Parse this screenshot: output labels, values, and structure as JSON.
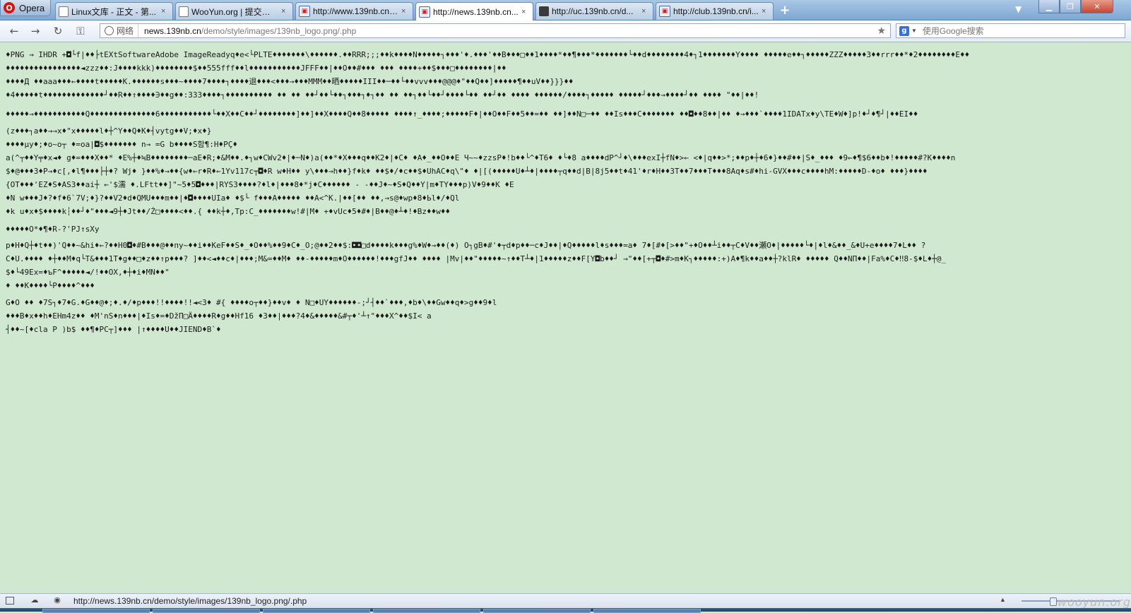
{
  "browser": {
    "menu_label": "Opera",
    "tabs": [
      {
        "label": "Linux文库 - 正文 - 第...",
        "icon": "document-favicon-icon"
      },
      {
        "label": "WooYun.org | 提交漏洞",
        "icon": "document-favicon-icon"
      },
      {
        "label": "http://www.139nb.cn/...",
        "icon": "site-139-favicon-icon"
      },
      {
        "label": "http://news.139nb.cn...",
        "icon": "site-139-favicon-icon",
        "active": true
      },
      {
        "label": "http://uc.139nb.cn/d...",
        "icon": "dark-favicon-icon"
      },
      {
        "label": "http://club.139nb.cn/i...",
        "icon": "site-139-favicon-icon"
      }
    ],
    "tab_close_glyph": "×",
    "add_tab_glyph": "+"
  },
  "address_bar": {
    "site_badge": "网络",
    "url_host": "news.139nb.cn",
    "url_path": "/demo/style/images/139nb_logo.png/.php",
    "search_placeholder": "使用Google搜索"
  },
  "content": {
    "lines": [
      "♦PNG → IHDR +◘└f|♦♦├tEXtSoftwareAdobe ImageReadyq♦e<└PLTE♦♦♦♦♦♦♦\\♦♦♦♦♦♦.♦♦RRR;;;♦♦k♦♦♦♦N♦♦♦♦♦┐♦♦♦'♦.♦♦♦'♦♦B♦♦♦□♦♦1♦♦♦♦*♦♦¶♦♦♦*♦♦♦♦♦♦♦└♦♦d♦♦♦♦♦♦♦♦4♦┐1♦♦♦♦♦♦♦Y♦♦♦♦  ♦♦♦♦♦e♦♦┐♦♦♦♦♦ZZZ♦♦♦♦♦3♦♦rrr♦♦*♦2♦♦♦♦♦♦♦♦E♦♦",
      "♦♦♦♦♦♦♦♦♦♦♦♦♦♦♦♦◄zzz♦♦:J♦♦♦♦kkk)♦♦♦♦♦♦♦♦$♦♦555fff♦♦l♦♦♦♦♦♦♦♦♦♦♦JFFF♦♦|♦♦O♦♦#♦♦♦  ♦♦♦ ♦♦♦♦+♦♦$♦♦♦□♦♦♦♦♦♦♦♦|♦♦",
      "♦♦♦♦Д ♦♦aaa♦♦♦←♦♦♦♦t♦♦♦♦♦K.♦♦♦♦♦♦s♦♦♦~♦♦♦♦7♦♦♦♦┐♦♦♦♦退♦♦♦<♦♦♦→♦♦♦MMM♦♦晒♦♦♦♦♦III♦♦─♦♦└♦♦vvv♦♦♦@@@♦\"♦♦Q♦♦]♦♦♦♦♦¶♦♦uV♦♦}}}♦♦",
      "♦4♦♦♦♦♦t♦♦♦♦♦♦♦♦♦♦♦♦♦┘♦♦R♦♦↑♦♦♦♦∋♦♦g♦♦:333♦♦♦♦┐♦♦♦♦♦♦♦♦♦♦  ♦♦  ♦♦  ♦♦┘♦♦└♦♦┐♦♦♦┐♦┐♦♦  ♦♦  ♦♦┐♦♦└♦♦┘♦♦♦♦└♦♦  ♦♦┘♦♦  ♦♦♦♦  ♦♦♦♦♦♦/♦♦♦♦┐♦♦♦♦♦  ♦♦♦♦♦┘♦♦♦→♦♦♦♦┘♦♦  ♦♦♦♦  \"♦♦|♦♦!",
      "♦♦♦♦♦→♦♦♦♦♦♦♦♦♦♦♦Q♦♦♦♦♦♦♦♦♦♦♦♦♦♦6♦♦♦♦♦♦♦♦♦♦♦└♦♦X♦♦C♦♦┘♦♦♦♦♦♦♦♦]♦♦]♦♦X♦♦♦♦Q♦♦8♦♦♦♦♦ ♦♦♦♦↑_♦♦♦♦;♦♦♦♦♦F♦|♦♦O♦♦F♦♦5♦♦=♦♦  ♦♦]♦♦N□─♦♦  ♦♦Is♦♦♦C♦♦♦♦♦♦♦  ♦♦◘♦♦8♦♦|♦♦ ♦→♦♦♦`♦♦♦♦1IDATx♦y\\TE♦W♦]p!♦┘♦¶┘|♦♦EI♦♦",
      "(z♦♦♦┐a♦♦→→x♦\"x♦♦♦♦♦l♦┼^Y♦♦Q♦K♦┤vytg♦♦V;♦x♦}",
      "♦♦♦♦µy♦;♦o~o┬ ♦=oa|◘$♦♦♦♦♦♦♦ n→ =G b♦♦♦♦S함¶:H♦PÇ♦",
      "a(^┬♦♦Y╤♦x◄♦ g♦=♦♦♦X♦♦* ♦E%┼♦≒B♦♦♦♦♦♦♦♦─aE♦R;♦&M♦♦.♦┐w♦CWv2♦|♦─N♦)a(♦♦*♦X♦♦♦q♦♦K2♦|♦C♦ ♦A♦_♦♦O♦♦E Ч~~♦zzsP♦!b♦♦└^♦T6♦ ♦└♦8 a♦♦♦♦dP^┘♦\\♦♦♦exI┼fN♦>← <♦|q♦♦>*;♦♦p♦┼♦6♦}♦♦#♦♦|S♦_♦♦♦  ♦9←♦¶$6♦♦b♦!♦♦♦♦♦#?K♦♦♦♦n",
      "$♦@♦♦♦3♦P→♦c[,♦l¶♦♦♦├┼♦? Wj♦ }♦♦%♦→♦♦{w♦←r♦R♦←1Yv117c┬◘♦R  w♦H♦♦ y\\♦♦♦→h♦♦}f♦k♦ ♦♦$♦/♦c♦♦$♦UhAC♦q\\\"♦ ♦|[(♦♦♦♦♦U♦┴♦|♦♦♦♦┬q♦♦d|B|8j5♦♦t♦41'♦r♦H♦♦3T♦♦7♦♦♦T♦♦♦8Aq♦s#♦hi-GVX♦♦♦c♦♦♦♦hM:♦♦♦♦♦D-♦o♦ ♦♦♦}♦♦♦♦",
      "{OT♦♦♦'EZ♦S♦AS3♦♦ai┼ ←'$濡 ♦.LFtt♦♦]\"~5♦5◘♦♦♦|RYS3♦♦♦♦?♦l♦|♦♦♦8♦*j♦C♦♦♦♦♦♦ - -♦♦J♦~♦S♦Q♦♦Y|m♦TY♦♦♦p)V♦9♦♦K ♦E",
      "♦N  w♦♦♦J♦?♦f♦6`7V;♦}?♦♦V2♦d♦QMU♦♦♦m♦♦|♦◘♦♦♦♦UIa♦  ♦$└ f♦♦♦A♦♦♦♦♦ ♦♦A<^K.|♦♦[♦♦ ♦♦,→s@♦wp♦8♦Ьl♦/♦Ql",
      "♦k u♦x♦$♦♦♦♦k┆♦♦┘♦\"♦♦♦◄9┼♦Jt♦♦/Ż□♦♦♦♦<♦♦.{ ♦♦k┼♦,Tp:C_♦♦♦♦♦♦♦w!#|M♦  +♦vUc♦5♦#♦|B♦♦@♦┴♦!♦Bz♦♦w♦♦",
      "♦♦♦♦♦O*♦¶♦R-?'PJ↑sXy",
      "p♦H♦Q┼♦t♦♦)'Q♦♦~&hi♦←?♦♦H0◘♦#B♦♦♦@♦♦пy~♦♦i♦♦KeF♦♦S♦_♦O♦♦%♦♦9♦C♦_O;@♦♦2♦♦$:◘◘□d♦♦♦♦k♦♦♦g%♦W♦→♦♦(♦) O┐gB♦#'♦┬d♦p♦♦─c♦J♦♦|♦Q♦♦♦♦♦l♦s♦♦♦=a♦ 7♦[#♦[>♦♦\"+♦O♦♦┴i♦♦┬C♦V♦♦瀬O♦|♦♦♦♦♦└♦|♦l♦&♦♦_&♦U+e♦♦♦♦7♦L♦♦ ?",
      "C♦U.♦♦♦♦ ♦┼♦♦M♦q└T&♦♦♦1T♦g♦♦□♦z♦♦↑p♦♦♦? ]♦♦<◄♦♦c♦|♦♦♦;M&=♦♦M♦ ♦♦-♦♦♦♦♦m♦O♦♦♦♦♦♦!♦♦♦gfJ♦♦ ♦♦♦♦ |Mv|♦♦\"♦♦♦♦♦~↑♦♦T┴♦|1♦♦♦♦♦z♦♦F[Y◘b♦♦┘ →\"♦♦[+┬◘♦#>m♦K┐♦♦♦♦♦:+)A♦¶k♦♦a♦♦┼?klR♦ ♦♦♦♦♦ Q♦♦NП♦♦|Fa%♦C♦‼8-$♦L♦┼@_",
      "$♦└49Ex=♦ъF^♦♦♦♦♦◄/!♦♦OX,♦┼♦i♦MN♦♦\"",
      "♦ ♦♦K♦♦♦♦└P♦♦♦♦^♦♦♦",
      "G♦O ♦♦ ♦7S┐♦7♦G.♦G♦♦@♦;♦.♦/♦p♦♦♦!!♦♦♦♦!!◄<3♦ #{ ♦♦♦♦o┬♦♦}♦♦v♦ ♦ N□♦UY♦♦♦♦♦♦-;┘┤♦♦`♦♦♦,♦b♦\\♦♦Gw♦♦q♦>g♦♦9♦l",
      "♦♦♦B♦x♦♦h♦EHm4z♦♦ ♦M'nS♦n♦♦♦|♦Is♦=♦DžП□Ä♦♦♦♦R♦g♦♦Hf16 ♦3♦♦|♦♦♦?4♦&♦♦♦♦♦&#┬♦'┴↑\"♦♦♦X^♦♦$I< a",
      "┤♦♦~[♦cla P )b$ ♦♦¶♦PC┬]♦♦♦ |↑♦♦♦♦U♦♦JIEND♦B`♦"
    ]
  },
  "status_bar": {
    "url": "http://news.139nb.cn/demo/style/images/139nb_logo.png/.php",
    "zoom_level": 0.3
  },
  "watermark": "wooyun.org"
}
